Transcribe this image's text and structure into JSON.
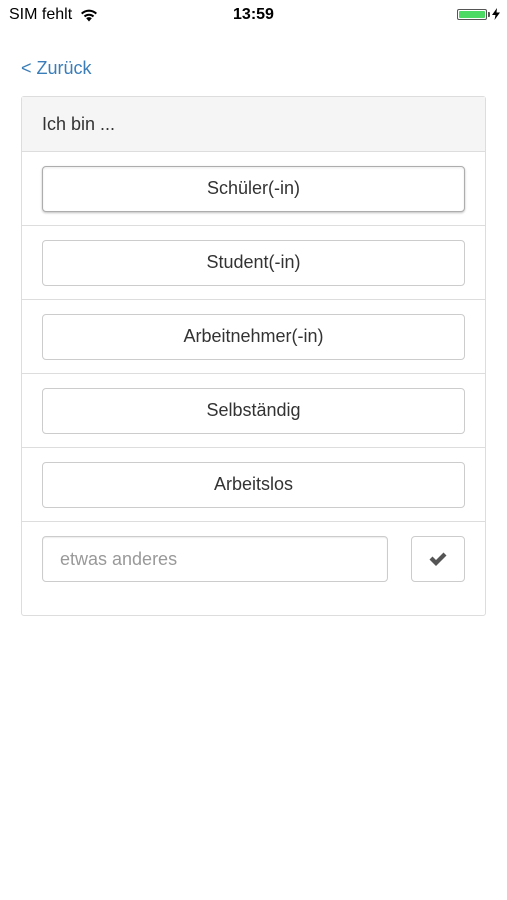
{
  "status_bar": {
    "carrier": "SIM fehlt",
    "wifi_icon": "wifi-icon",
    "time": "13:59",
    "battery_icon": "battery-icon",
    "battery_level": 1.0,
    "battery_color": "#4cd964",
    "charging_icon": "bolt-icon"
  },
  "nav": {
    "back_label": "< Zurück",
    "link_color": "#3a7db8"
  },
  "panel": {
    "heading": "Ich bin ...",
    "options": [
      {
        "label": "Schüler(-in)"
      },
      {
        "label": "Student(-in)"
      },
      {
        "label": "Arbeitnehmer(-in)"
      },
      {
        "label": "Selbständig"
      },
      {
        "label": "Arbeitslos"
      }
    ],
    "other_input": {
      "value": "",
      "placeholder": "etwas anderes"
    },
    "confirm_icon": "check-icon"
  }
}
